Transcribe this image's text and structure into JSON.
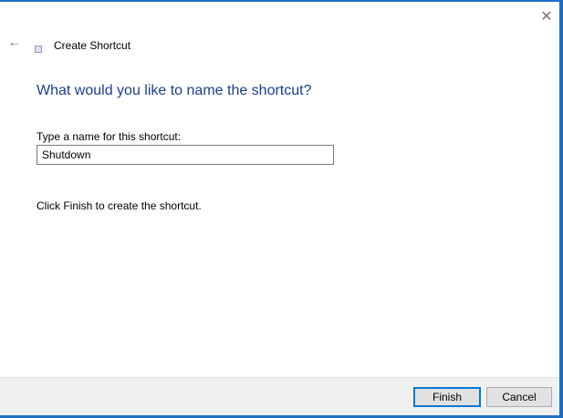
{
  "window": {
    "title": "Create Shortcut"
  },
  "main": {
    "heading": "What would you like to name the shortcut?",
    "name_label": "Type a name for this shortcut:",
    "name_value": "Shutdown",
    "hint": "Click Finish to create the shortcut."
  },
  "footer": {
    "finish": "Finish",
    "cancel": "Cancel"
  },
  "icons": {
    "close": "✕",
    "back": "🡐"
  }
}
